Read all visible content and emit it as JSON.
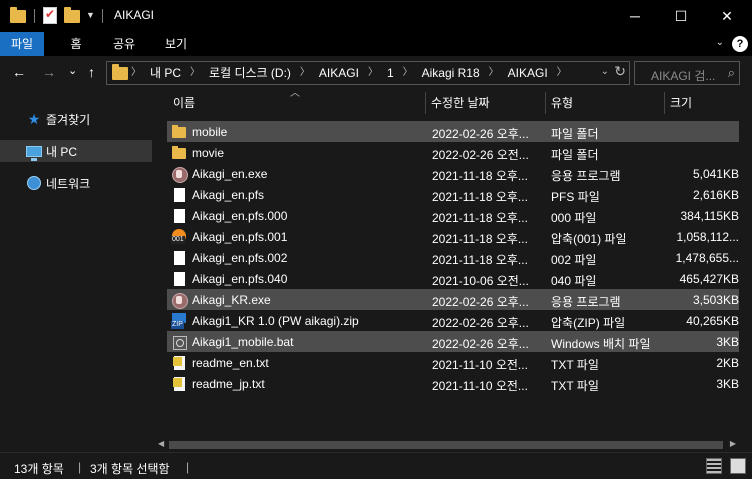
{
  "window": {
    "title": "AIKAGI",
    "minimize": "─",
    "maximize": "☐",
    "close": "✕"
  },
  "ribbon": {
    "tabs": [
      {
        "label": "파일",
        "active": true
      },
      {
        "label": "홈",
        "active": false
      },
      {
        "label": "공유",
        "active": false
      },
      {
        "label": "보기",
        "active": false
      }
    ],
    "help": "?"
  },
  "nav": {
    "back": "←",
    "forward": "→",
    "recent": "⌄",
    "up": "↑",
    "breadcrumb": [
      "내 PC",
      "로컬 디스크 (D:)",
      "AIKAGI",
      "1",
      "Aikagi R18",
      "AIKAGI"
    ],
    "search_placeholder": "AIKAGI 검...",
    "refresh": "↻"
  },
  "sidebar": {
    "items": [
      {
        "label": "즐겨찾기",
        "icon": "star-icon"
      },
      {
        "label": "내 PC",
        "icon": "computer-icon",
        "selected": true
      },
      {
        "label": "네트워크",
        "icon": "network-icon"
      }
    ]
  },
  "columns": {
    "name": "이름",
    "date": "수정한 날짜",
    "type": "유형",
    "size": "크기"
  },
  "files": [
    {
      "name": "mobile",
      "date": "2022-02-26 오후...",
      "type": "파일 폴더",
      "size": "",
      "icon": "folder",
      "selected": true
    },
    {
      "name": "movie",
      "date": "2022-02-26 오전...",
      "type": "파일 폴더",
      "size": "",
      "icon": "folder"
    },
    {
      "name": "Aikagi_en.exe",
      "date": "2021-11-18 오후...",
      "type": "응용 프로그램",
      "size": "5,041KB",
      "icon": "app"
    },
    {
      "name": "Aikagi_en.pfs",
      "date": "2021-11-18 오후...",
      "type": "PFS 파일",
      "size": "2,616KB",
      "icon": "file"
    },
    {
      "name": "Aikagi_en.pfs.000",
      "date": "2021-11-18 오후...",
      "type": "000 파일",
      "size": "384,115KB",
      "icon": "file"
    },
    {
      "name": "Aikagi_en.pfs.001",
      "date": "2021-11-18 오후...",
      "type": "압축(001) 파일",
      "size": "1,058,112...",
      "icon": "num"
    },
    {
      "name": "Aikagi_en.pfs.002",
      "date": "2021-11-18 오후...",
      "type": "002 파일",
      "size": "1,478,655...",
      "icon": "file"
    },
    {
      "name": "Aikagi_en.pfs.040",
      "date": "2021-10-06 오전...",
      "type": "040 파일",
      "size": "465,427KB",
      "icon": "file"
    },
    {
      "name": "Aikagi_KR.exe",
      "date": "2022-02-26 오후...",
      "type": "응용 프로그램",
      "size": "3,503KB",
      "icon": "app",
      "selected": true
    },
    {
      "name": "Aikagi1_KR 1.0 (PW aikagi).zip",
      "date": "2022-02-26 오후...",
      "type": "압축(ZIP) 파일",
      "size": "40,265KB",
      "icon": "zip"
    },
    {
      "name": "Aikagi1_mobile.bat",
      "date": "2022-02-26 오후...",
      "type": "Windows 배치 파일",
      "size": "3KB",
      "icon": "bat",
      "selected": true
    },
    {
      "name": "readme_en.txt",
      "date": "2021-11-10 오전...",
      "type": "TXT 파일",
      "size": "2KB",
      "icon": "txt"
    },
    {
      "name": "readme_jp.txt",
      "date": "2021-11-10 오전...",
      "type": "TXT 파일",
      "size": "3KB",
      "icon": "txt"
    }
  ],
  "status": {
    "count": "13개 항목",
    "selected": "3개 항목 선택함"
  }
}
